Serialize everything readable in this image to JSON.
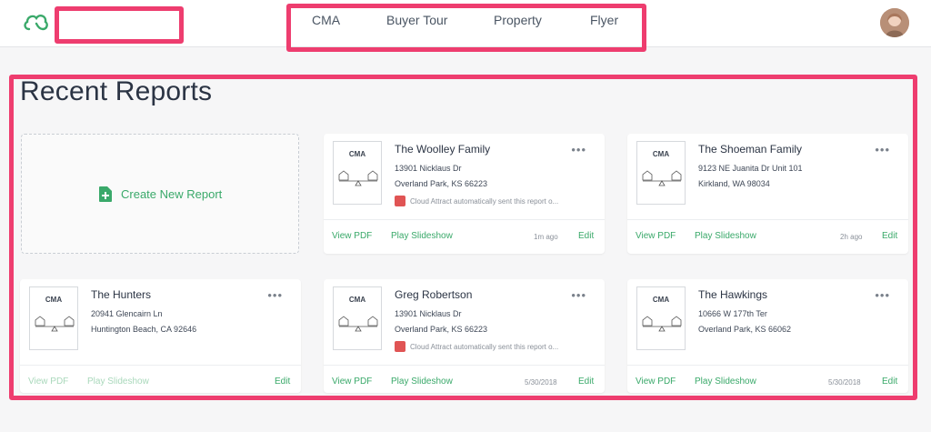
{
  "nav": {
    "items": [
      "CMA",
      "Buyer Tour",
      "Property",
      "Flyer"
    ]
  },
  "colors": {
    "accent": "#3aa96a",
    "highlight": "#ee3d6f",
    "note_icon": "#e05454"
  },
  "page": {
    "title": "Recent Reports"
  },
  "create": {
    "label": "Create New Report"
  },
  "reports": [
    {
      "thumb": "CMA",
      "name": "The Woolley Family",
      "addr1": "13901 Nicklaus Dr",
      "addr2": "Overland Park, KS 66223",
      "note": "Cloud Attract automatically sent this report o...",
      "menu": "•••",
      "view": "View PDF",
      "play": "Play Slideshow",
      "time": "1m ago",
      "edit": "Edit"
    },
    {
      "thumb": "CMA",
      "name": "The Shoeman Family",
      "addr1": "9123 NE Juanita Dr Unit 101",
      "addr2": "Kirkland, WA 98034",
      "note": "",
      "menu": "•••",
      "view": "View PDF",
      "play": "Play Slideshow",
      "time": "2h ago",
      "edit": "Edit"
    },
    {
      "thumb": "CMA",
      "name": "The Hunters",
      "addr1": "20941 Glencairn Ln",
      "addr2": "Huntington Beach, CA 92646",
      "note": "",
      "menu": "•••",
      "view": "View PDF",
      "play": "Play Slideshow",
      "time": "",
      "edit": "Edit"
    },
    {
      "thumb": "CMA",
      "name": "Greg Robertson",
      "addr1": "13901 Nicklaus Dr",
      "addr2": "Overland Park, KS 66223",
      "note": "Cloud Attract automatically sent this report o...",
      "menu": "•••",
      "view": "View PDF",
      "play": "Play Slideshow",
      "time": "5/30/2018",
      "edit": "Edit"
    },
    {
      "thumb": "CMA",
      "name": "The Hawkings",
      "addr1": "10666 W 177th Ter",
      "addr2": "Overland Park, KS 66062",
      "note": "",
      "menu": "•••",
      "view": "View PDF",
      "play": "Play Slideshow",
      "time": "5/30/2018",
      "edit": "Edit"
    }
  ]
}
